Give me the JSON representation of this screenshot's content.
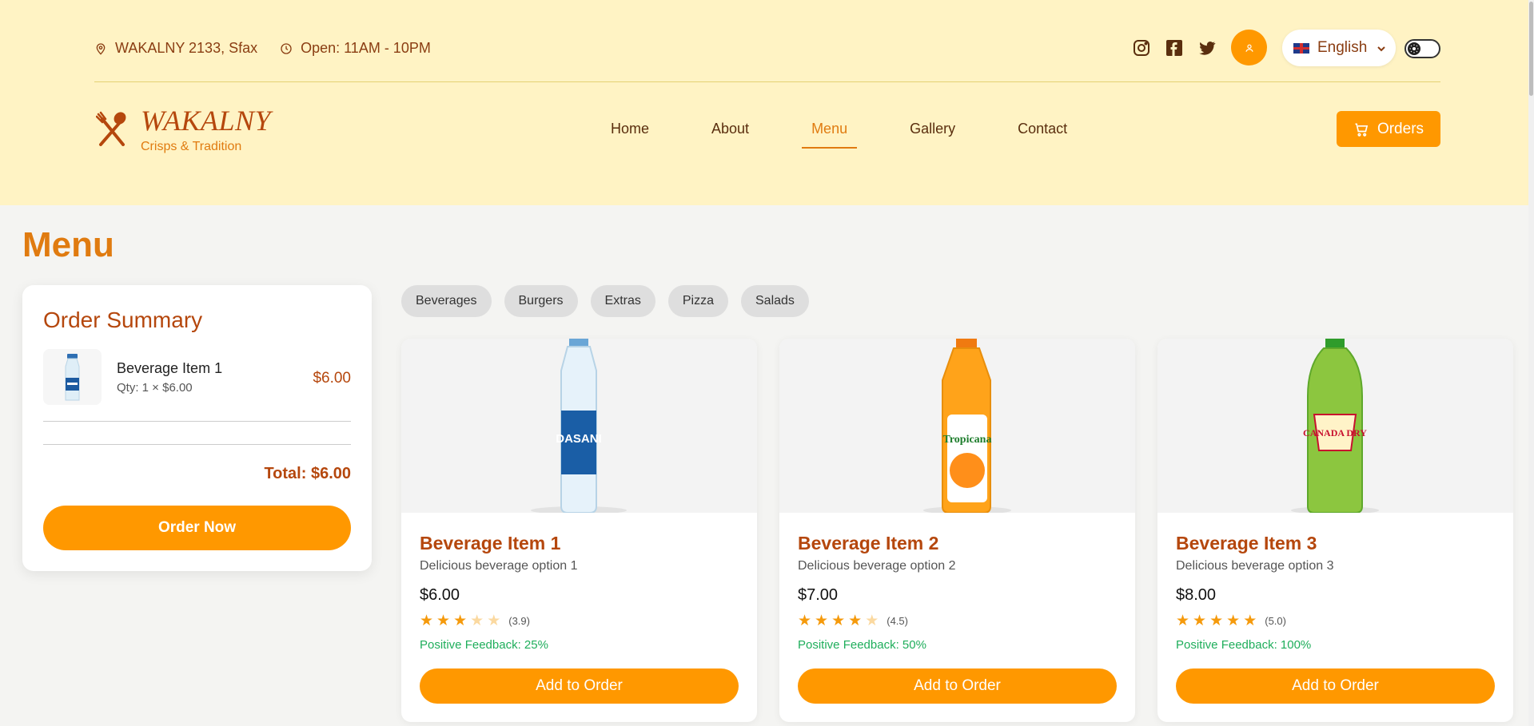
{
  "topbar": {
    "address": "WAKALNY 2133, Sfax",
    "hours": "Open: 11AM - 10PM",
    "language": "English"
  },
  "brand": {
    "name": "WAKALNY",
    "tagline": "Crisps & Tradition"
  },
  "nav": {
    "items": [
      {
        "label": "Home"
      },
      {
        "label": "About"
      },
      {
        "label": "Menu",
        "active": true
      },
      {
        "label": "Gallery"
      },
      {
        "label": "Contact"
      }
    ]
  },
  "orders_button": "Orders",
  "page_title": "Menu",
  "summary": {
    "title": "Order Summary",
    "items": [
      {
        "name": "Beverage Item 1",
        "qty": "Qty: 1 × $6.00",
        "price": "$6.00"
      }
    ],
    "total": "Total: $6.00",
    "order_button": "Order Now"
  },
  "categories": [
    "Beverages",
    "Burgers",
    "Extras",
    "Pizza",
    "Salads"
  ],
  "products": [
    {
      "name": "Beverage Item 1",
      "description": "Delicious beverage option 1",
      "price": "$6.00",
      "rating": 3.9,
      "rating_text": "(3.9)",
      "feedback": "Positive Feedback: 25%",
      "button": "Add to Order",
      "image_label": "DASANI"
    },
    {
      "name": "Beverage Item 2",
      "description": "Delicious beverage option 2",
      "price": "$7.00",
      "rating": 4.5,
      "rating_text": "(4.5)",
      "feedback": "Positive Feedback: 50%",
      "button": "Add to Order",
      "image_label": "Tropicana"
    },
    {
      "name": "Beverage Item 3",
      "description": "Delicious beverage option 3",
      "price": "$8.00",
      "rating": 5.0,
      "rating_text": "(5.0)",
      "feedback": "Positive Feedback: 100%",
      "button": "Add to Order",
      "image_label": "CANADA DRY"
    }
  ],
  "colors": {
    "accent": "#ff9800",
    "brand_brown": "#b5470d",
    "header_bg": "#fff3c4",
    "feedback_green": "#1fae5b"
  }
}
